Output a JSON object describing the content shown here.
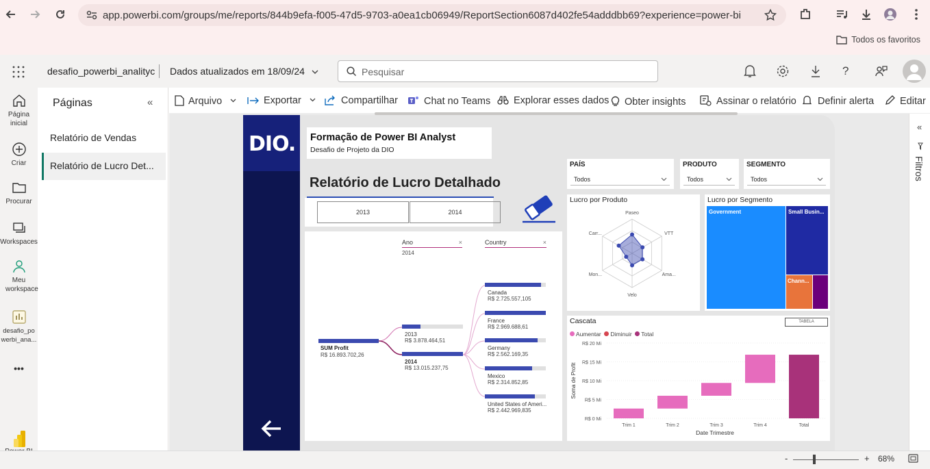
{
  "browser": {
    "url": "app.powerbi.com/groups/me/reports/844b9efa-f005-47d5-9703-a0ea1cb06949/ReportSection6087d402fe54adddbb69?experience=power-bi",
    "favorites_label": "Todos os favoritos"
  },
  "header": {
    "workspace": "desafio_powerbi_analityc",
    "updated": "Dados atualizados em 18/09/24",
    "search_placeholder": "Pesquisar"
  },
  "rail": {
    "home": "Página inicial",
    "create": "Criar",
    "browse": "Procurar",
    "workspaces": "Workspaces",
    "my_workspace": "Meu workspace",
    "report": "desafio_po werbi_ana...",
    "more": "•••",
    "brand": "Power BI"
  },
  "pages": {
    "title": "Páginas",
    "items": [
      {
        "label": "Relatório de Vendas"
      },
      {
        "label": "Relatório de Lucro Det..."
      }
    ]
  },
  "toolbar": {
    "file": "Arquivo",
    "export": "Exportar",
    "share": "Compartilhar",
    "teams": "Chat no Teams",
    "explore": "Explorar esses dados",
    "insights": "Obter insights",
    "subscribe": "Assinar o relatório",
    "alert": "Definir alerta",
    "edit": "Editar"
  },
  "filters_label": "Filtros",
  "status": {
    "zoom": "68%",
    "minus": "-",
    "plus": "+"
  },
  "report": {
    "brand_logo": "DIO.",
    "title": "Formação de Power BI Analyst",
    "subtitle": "Desafio de Projeto da DIO",
    "page_title": "Relatório de Lucro Detalhado",
    "years": [
      "2013",
      "2014"
    ],
    "slicers": [
      {
        "label": "PAÍS",
        "value": "Todos"
      },
      {
        "label": "PRODUTO",
        "value": "Todos"
      },
      {
        "label": "SEGMENTO",
        "value": "Todos"
      }
    ],
    "tree": {
      "filter1_label": "Ano",
      "filter1_value": "2014",
      "filter2_label": "Country",
      "close": "×",
      "root_label": "SUM Profit",
      "root_value": "R$ 16.893.702,26",
      "years": [
        {
          "label": "2013",
          "value": "R$ 3.878.464,51",
          "fill": 0.3
        },
        {
          "label": "2014",
          "value": "R$ 13.015.237,75",
          "fill": 1.0
        }
      ],
      "countries": [
        {
          "label": "Canada",
          "value": "R$ 2.725.557,105",
          "fill": 0.92
        },
        {
          "label": "France",
          "value": "R$ 2.969.688,61",
          "fill": 1.0
        },
        {
          "label": "Germany",
          "value": "R$ 2.562.169,35",
          "fill": 0.86
        },
        {
          "label": "Mexico",
          "value": "R$ 2.314.852,85",
          "fill": 0.78
        },
        {
          "label": "United States of Ameri...",
          "value": "R$ 2.442.969,835",
          "fill": 0.82
        }
      ]
    },
    "radar": {
      "title": "Lucro por Produto",
      "axes": [
        "Paseo",
        "VTT",
        "Ama...",
        "Velo",
        "Mon...",
        "Carr..."
      ],
      "values": [
        0.55,
        0.35,
        0.35,
        0.35,
        0.2,
        0.45
      ]
    },
    "treemap": {
      "title": "Lucro por Segmento",
      "items": [
        {
          "label": "Government",
          "color": "#1a8cff"
        },
        {
          "label": "Small Busin...",
          "color": "#1f2aa3"
        },
        {
          "label": "Chann...",
          "color": "#e8743b"
        },
        {
          "label": "",
          "color": "#6b007b"
        }
      ]
    },
    "waterfall": {
      "title": "Cascata",
      "button": "TABELA",
      "legend": [
        {
          "label": "Aumentar",
          "color": "#e66cbd"
        },
        {
          "label": "Diminuir",
          "color": "#d64550"
        },
        {
          "label": "Total",
          "color": "#a8327a"
        }
      ],
      "ylabel": "Soma de Profit",
      "xlabel": "Date Trimestre",
      "yticks": [
        "R$ 20 Mi",
        "R$ 15 Mi",
        "R$ 10 Mi",
        "R$ 5 Mi",
        "R$ 0 Mi"
      ]
    }
  },
  "chart_data": {
    "type": "bar",
    "title": "Cascata",
    "xlabel": "Date Trimestre",
    "ylabel": "Soma de Profit",
    "ylim": [
      0,
      20
    ],
    "categories": [
      "Trim 1",
      "Trim 2",
      "Trim 3",
      "Trim 4",
      "Total"
    ],
    "series": [
      {
        "name": "Aumentar",
        "start": [
          0,
          2.6,
          6.0,
          9.4,
          0
        ],
        "end": [
          2.6,
          6.0,
          9.4,
          16.9,
          16.9
        ]
      }
    ],
    "kinds": [
      "Aumentar",
      "Aumentar",
      "Aumentar",
      "Aumentar",
      "Total"
    ]
  }
}
